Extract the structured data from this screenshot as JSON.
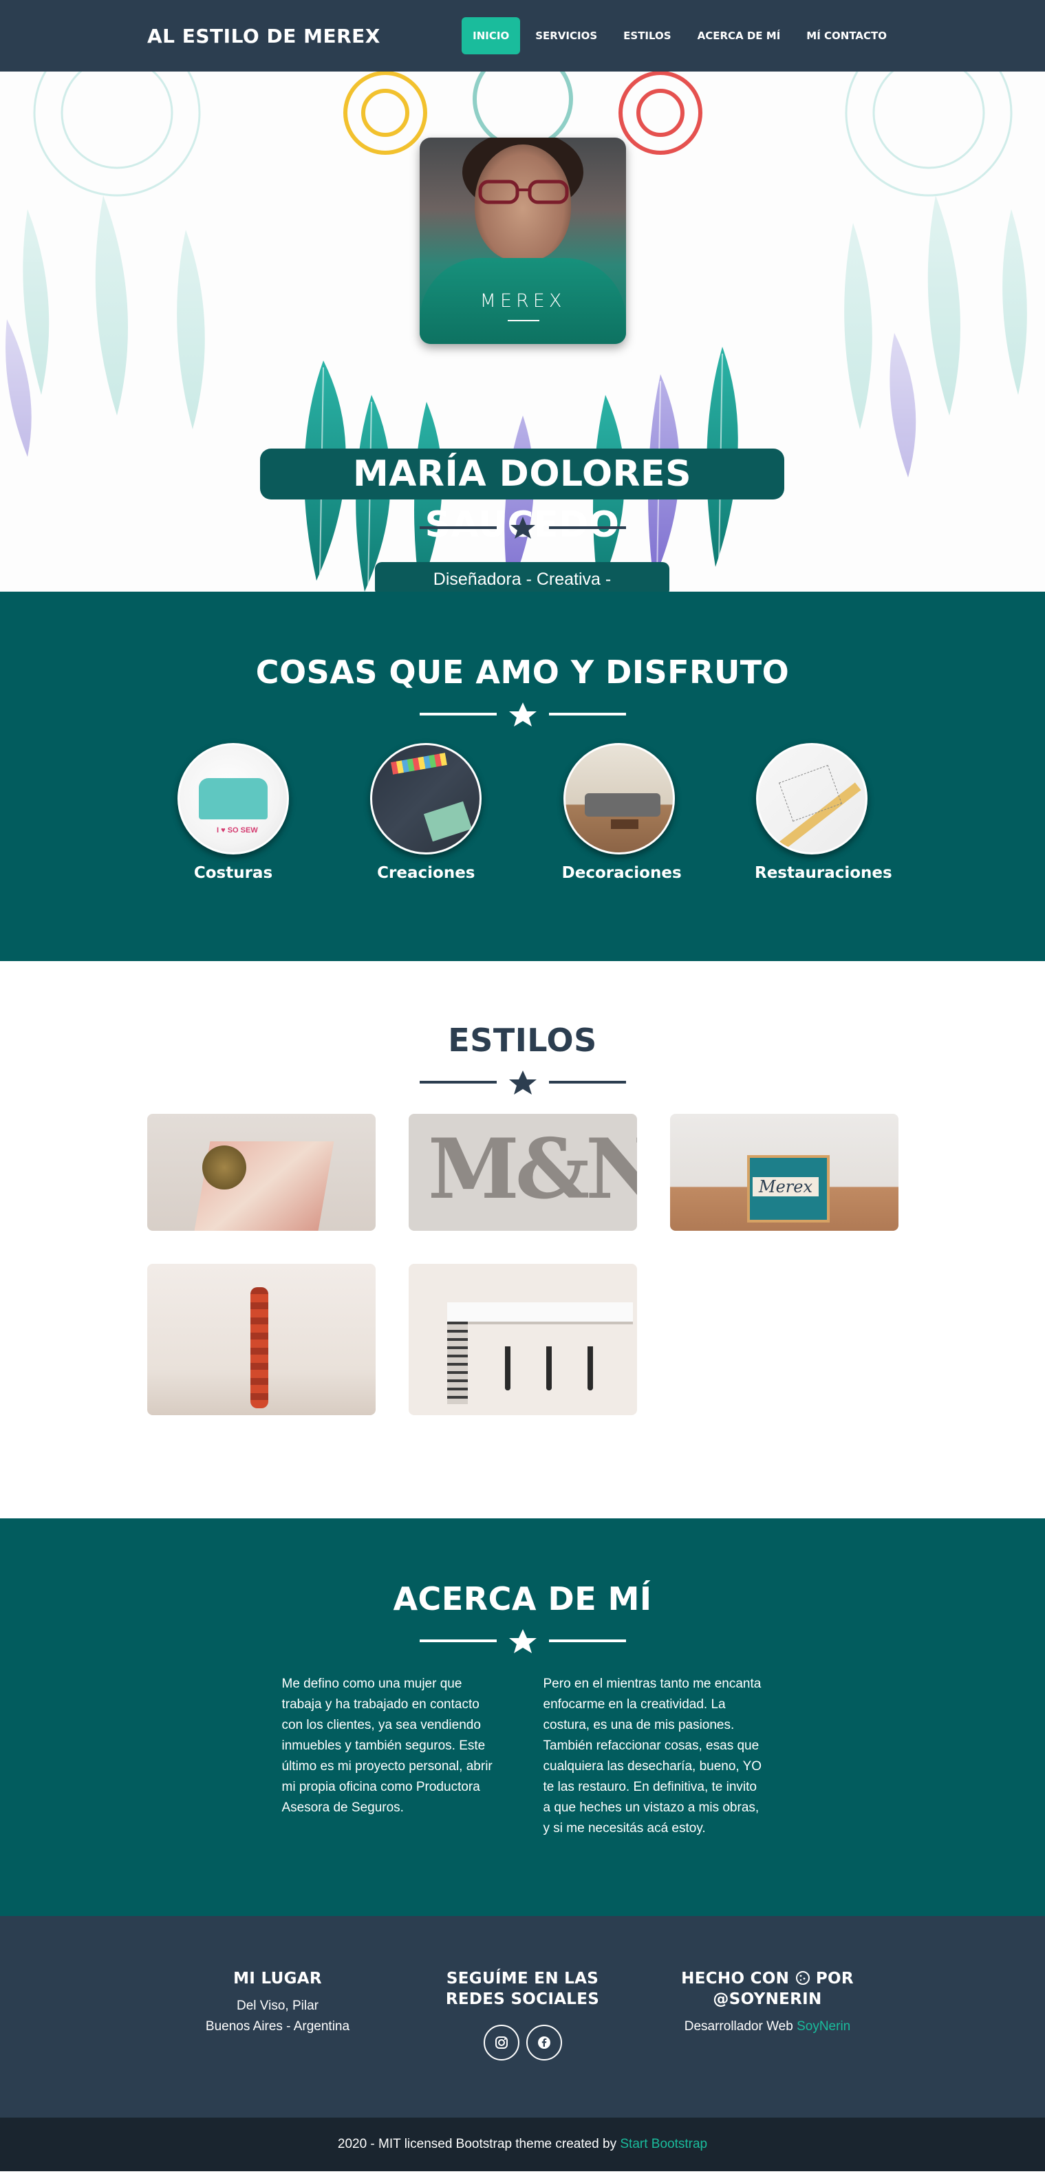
{
  "nav": {
    "brand": "AL ESTILO DE MEREX",
    "items": [
      {
        "label": "INICIO",
        "active": true
      },
      {
        "label": "SERVICIOS",
        "active": false
      },
      {
        "label": "ESTILOS",
        "active": false
      },
      {
        "label": "ACERCA DE MÍ",
        "active": false
      },
      {
        "label": "MÍ CONTACTO",
        "active": false
      }
    ]
  },
  "hero": {
    "watermark": "MEREX",
    "name": "MARÍA DOLORES SAUCEDO",
    "subtitle": "Diseñadora - Creativa - Emprendedora",
    "divider_icon": "star-icon"
  },
  "cosas": {
    "title": "COSAS QUE AMO Y DISFRUTO",
    "items": [
      {
        "label": "Costuras"
      },
      {
        "label": "Creaciones"
      },
      {
        "label": "Decoraciones"
      },
      {
        "label": "Restauraciones"
      }
    ]
  },
  "estilos": {
    "title": "ESTILOS",
    "tile_count": 5
  },
  "acerca": {
    "title": "ACERCA DE MÍ",
    "col1": "Me defino como una mujer que trabaja y ha trabajado en contacto con los clientes, ya sea vendiendo inmuebles y también seguros. Este último es mi proyecto personal, abrir mi propia oficina como Productora Asesora de Seguros.",
    "col2": "Pero en el mientras tanto me encanta enfocarme en la creatividad. La costura, es una de mis pasiones. También refaccionar cosas, esas que cualquiera las desecharía, bueno, YO te las restauro. En definitiva, te invito a que heches un vistazo a mis obras, y si me necesitás acá estoy."
  },
  "footer": {
    "col1": {
      "title": "MI LUGAR",
      "line1": "Del Viso, Pilar",
      "line2": "Buenos Aires - Argentina"
    },
    "col2": {
      "title": "SEGUÍME EN LAS REDES SOCIALES",
      "icons": [
        "instagram-icon",
        "facebook-icon"
      ]
    },
    "col3": {
      "title_pre": "HECHO CON",
      "title_icon": "cookie-icon",
      "title_post": "POR",
      "title_line2": "@SOYNERIN",
      "text": "Desarrollador Web",
      "link": "SoyNerin"
    },
    "copyright_text": "2020 - MIT licensed Bootstrap theme created by",
    "copyright_link": "Start Bootstrap"
  },
  "colors": {
    "navbar": "#2c3e50",
    "accent": "#1abc9c",
    "teal_section": "#025c5e",
    "hero_label_bg": "#0b5a5a",
    "footer_bottom": "#1a252f"
  }
}
